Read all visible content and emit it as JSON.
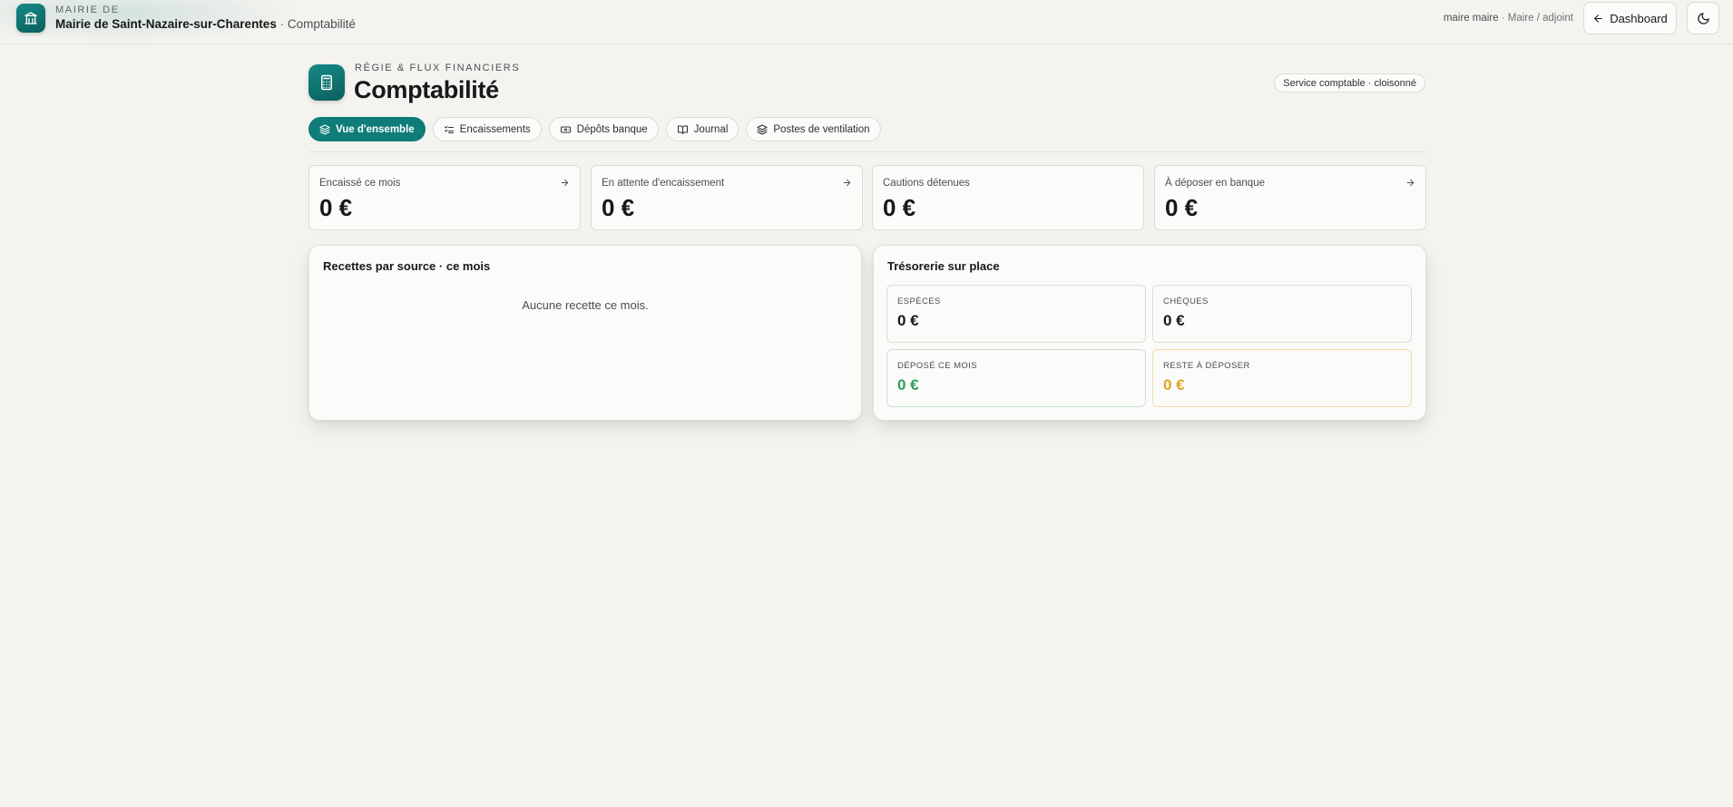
{
  "header": {
    "kicker": "MAIRIE DE",
    "municipality": "Mairie de Saint-Nazaire-sur-Charentes",
    "separator": " · ",
    "section": "Comptabilité",
    "user_name": "maire maire",
    "user_role": " · Maire / adjoint",
    "dashboard_label": "Dashboard",
    "logo_icon": "bank-building-icon",
    "theme_icon": "moon-icon"
  },
  "page": {
    "kicker": "RÉGIE & FLUX FINANCIERS",
    "title": "Comptabilité",
    "badge": "Service comptable · cloisonné",
    "icon": "calculator-icon"
  },
  "tabs": [
    {
      "label": "Vue d'ensemble",
      "icon": "layers-icon",
      "active": true
    },
    {
      "label": "Encaissements",
      "icon": "list-checks-icon",
      "active": false
    },
    {
      "label": "Dépôts banque",
      "icon": "banknote-icon",
      "active": false
    },
    {
      "label": "Journal",
      "icon": "book-open-icon",
      "active": false
    },
    {
      "label": "Postes de ventilation",
      "icon": "layers-icon",
      "active": false
    }
  ],
  "stats": [
    {
      "label": "Encaissé ce mois",
      "value": "0 €",
      "has_arrow": true
    },
    {
      "label": "En attente d'encaissement",
      "value": "0 €",
      "has_arrow": true
    },
    {
      "label": "Cautions détenues",
      "value": "0 €",
      "has_arrow": false
    },
    {
      "label": "À déposer en banque",
      "value": "0 €",
      "has_arrow": true
    }
  ],
  "recettes_panel": {
    "title": "Recettes par source · ce mois",
    "empty_text": "Aucune recette ce mois."
  },
  "tresorerie_panel": {
    "title": "Trésorerie sur place",
    "cards": [
      {
        "label": "ESPÈCES",
        "value": "0 €",
        "color": "#16181a"
      },
      {
        "label": "CHÈQUES",
        "value": "0 €",
        "color": "#16181a"
      },
      {
        "label": "DÉPOSÉ CE MOIS",
        "value": "0 €",
        "color": "#2e9e5b"
      },
      {
        "label": "RESTE À DÉPOSER",
        "value": "0 €",
        "color": "#e0a526"
      }
    ]
  },
  "colors": {
    "accent": "#0f7c79",
    "background": "#f4f3ef",
    "positive": "#2e9e5b",
    "warning": "#e0a526"
  }
}
